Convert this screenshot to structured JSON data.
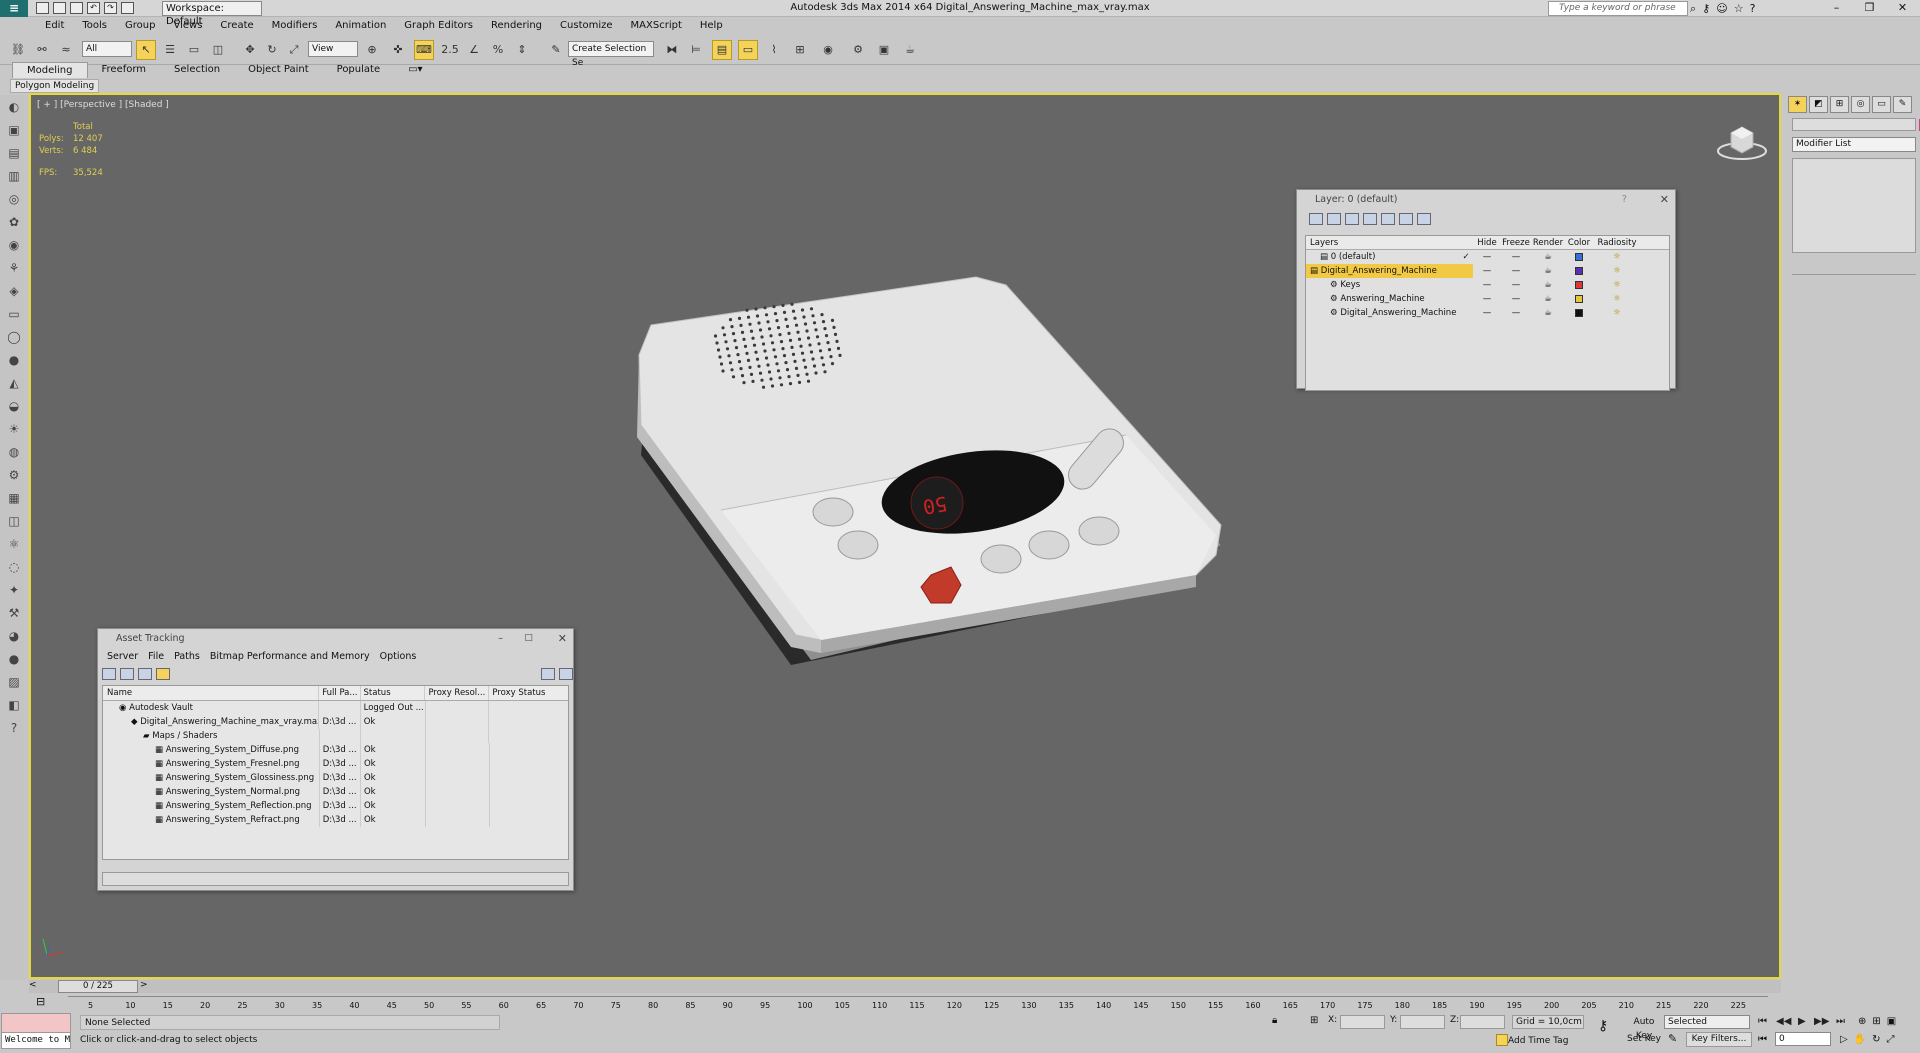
{
  "app": {
    "title": "Autodesk 3ds Max  2014 x64    Digital_Answering_Machine_max_vray.max",
    "workspace": "Workspace: Default",
    "search_placeholder": "Type a keyword or phrase"
  },
  "menu": [
    "Edit",
    "Tools",
    "Group",
    "Views",
    "Create",
    "Modifiers",
    "Animation",
    "Graph Editors",
    "Rendering",
    "Customize",
    "MAXScript",
    "Help"
  ],
  "toolbar": {
    "filter": "All",
    "ref_coord": "View",
    "selection_set": "Create Selection Se"
  },
  "ribbon": {
    "tabs": [
      "Modeling",
      "Freeform",
      "Selection",
      "Object Paint",
      "Populate"
    ],
    "active_tab": "Modeling",
    "sub_tab": "Polygon Modeling"
  },
  "viewport": {
    "label": "[ + ] [Perspective ] [Shaded ]",
    "stats": {
      "total_label": "Total",
      "polys_label": "Polys:",
      "polys": "12 407",
      "verts_label": "Verts:",
      "verts": "6 484",
      "fps_label": "FPS:",
      "fps": "35,524"
    },
    "display_digits": "50"
  },
  "layer_window": {
    "title": "Layer: 0 (default)",
    "help": "?",
    "headers": [
      "Layers",
      "Hide",
      "Freeze",
      "Render",
      "Color",
      "Radiosity"
    ],
    "rows": [
      {
        "name": "0 (default)",
        "color": "#3a6fd8",
        "checked": true,
        "indent": 1
      },
      {
        "name": "Digital_Answering_Machine",
        "color": "#5a2fb0",
        "checked": false,
        "indent": 0,
        "highlight": true
      },
      {
        "name": "Keys",
        "color": "#d83a3a",
        "checked": false,
        "indent": 2
      },
      {
        "name": "Answering_Machine",
        "color": "#e6c63a",
        "checked": false,
        "indent": 2
      },
      {
        "name": "Digital_Answering_Machine",
        "color": "#111111",
        "checked": false,
        "indent": 2
      }
    ]
  },
  "asset_tracking": {
    "title": "Asset Tracking",
    "menu": [
      "Server",
      "File",
      "Paths",
      "Bitmap Performance and Memory",
      "Options"
    ],
    "headers": [
      "Name",
      "Full Pa...",
      "Status",
      "Proxy Resol...",
      "Proxy Status"
    ],
    "rows": [
      {
        "name": "Autodesk Vault",
        "path": "",
        "status": "Logged Out ...",
        "indent": 1
      },
      {
        "name": "Digital_Answering_Machine_max_vray.max",
        "path": "D:\\3d ...",
        "status": "Ok",
        "indent": 2
      },
      {
        "name": "Maps / Shaders",
        "path": "",
        "status": "",
        "indent": 3
      },
      {
        "name": "Answering_System_Diffuse.png",
        "path": "D:\\3d ...",
        "status": "Ok",
        "indent": 4
      },
      {
        "name": "Answering_System_Fresnel.png",
        "path": "D:\\3d ...",
        "status": "Ok",
        "indent": 4
      },
      {
        "name": "Answering_System_Glossiness.png",
        "path": "D:\\3d ...",
        "status": "Ok",
        "indent": 4
      },
      {
        "name": "Answering_System_Normal.png",
        "path": "D:\\3d ...",
        "status": "Ok",
        "indent": 4
      },
      {
        "name": "Answering_System_Reflection.png",
        "path": "D:\\3d ...",
        "status": "Ok",
        "indent": 4
      },
      {
        "name": "Answering_System_Refract.png",
        "path": "D:\\3d ...",
        "status": "Ok",
        "indent": 4
      }
    ]
  },
  "command_panel": {
    "modifier_list": "Modifier List"
  },
  "timeline": {
    "frame": "0 / 225",
    "ticks": [
      "5",
      "10",
      "15",
      "20",
      "25",
      "30",
      "35",
      "40",
      "45",
      "50",
      "55",
      "60",
      "65",
      "70",
      "75",
      "80",
      "85",
      "90",
      "95",
      "100",
      "105",
      "110",
      "115",
      "120",
      "125",
      "130",
      "135",
      "140",
      "145",
      "150",
      "155",
      "160",
      "165",
      "170",
      "175",
      "180",
      "185",
      "190",
      "195",
      "200",
      "205",
      "210",
      "215",
      "220",
      "225"
    ]
  },
  "status": {
    "maxscript": "Welcome to M",
    "selection": "None Selected",
    "prompt": "Click or click-and-drag to select objects",
    "x_label": "X:",
    "y_label": "Y:",
    "z_label": "Z:",
    "grid": "Grid = 10,0cm",
    "add_time_tag": "Add Time Tag",
    "auto_key": "Auto Key",
    "set_key": "Set Key",
    "selected": "Selected",
    "key_filters": "Key Filters...",
    "current_frame": "0"
  }
}
